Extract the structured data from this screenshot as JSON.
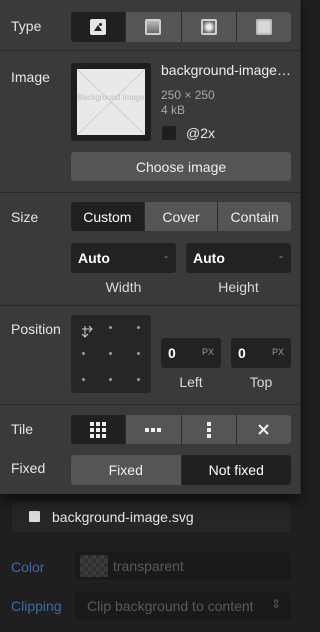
{
  "type_section": {
    "label": "Type",
    "options": [
      "image",
      "linear-gradient",
      "radial-gradient",
      "solid-color"
    ],
    "active": "image"
  },
  "image_section": {
    "label": "Image",
    "thumbnail_placeholder": "Background Image",
    "filename": "background-image.svg",
    "dimensions": "250 × 250",
    "filesize": "4 kB",
    "retina_label": "@2x",
    "choose_button": "Choose image"
  },
  "size_section": {
    "label": "Size",
    "modes": [
      "Custom",
      "Cover",
      "Contain"
    ],
    "active_mode": "Custom",
    "width": {
      "value": "Auto",
      "unit": "-",
      "label": "Width"
    },
    "height": {
      "value": "Auto",
      "unit": "-",
      "label": "Height"
    }
  },
  "position_section": {
    "label": "Position",
    "left": {
      "value": "0",
      "unit": "PX",
      "label": "Left"
    },
    "top": {
      "value": "0",
      "unit": "PX",
      "label": "Top"
    }
  },
  "tile_section": {
    "label": "Tile",
    "options": [
      "tile-both-icon",
      "tile-horizontal-icon",
      "tile-vertical-icon",
      "no-tile-icon"
    ],
    "active": "tile-both-icon"
  },
  "fixed_section": {
    "label": "Fixed",
    "options": [
      "Fixed",
      "Not fixed"
    ],
    "active": "Not fixed"
  },
  "layer_item": {
    "name": "background-image.svg"
  },
  "color_row": {
    "label": "Color",
    "value": "transparent"
  },
  "clipping_row": {
    "label": "Clipping",
    "value": "Clip background to content"
  },
  "colors": {
    "panel": "#3a3a3a",
    "active": "#202020",
    "button": "#555555",
    "dim_label": "#3d6aa8"
  }
}
